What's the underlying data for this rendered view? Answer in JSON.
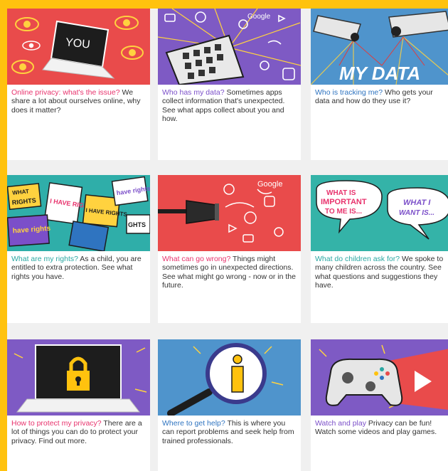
{
  "colors": {
    "frame": "#ffc20e",
    "pink": "#e8336d",
    "purple": "#7b4fc9",
    "teal": "#2aa7a2",
    "blue": "#2f74c0"
  },
  "cards": [
    {
      "name": "online-privacy",
      "title": "Online privacy: what's the issue?",
      "title_color": "#e8336d",
      "body": "We share a lot about ourselves online, why does it matter?",
      "image": {
        "icon": "laptop-eyes-icon",
        "label": "YOU"
      }
    },
    {
      "name": "who-has-my-data",
      "title": "Who has my data?",
      "title_color": "#7b4fc9",
      "body": "Sometimes apps collect information that's unexpected. See what apps collect about you and how.",
      "image": {
        "icon": "phone-apps-icon",
        "label": "Google"
      }
    },
    {
      "name": "who-is-tracking-me",
      "title": "Who is tracking me?",
      "title_color": "#2f74c0",
      "body": "Who gets your data and how do they use it?",
      "image": {
        "icon": "cctv-camera-icon",
        "label": "MY DATA"
      }
    },
    {
      "name": "what-are-my-rights",
      "title": "What are my rights?",
      "title_color": "#2aa7a2",
      "body": "As a child, you are entitled to extra protection. See what rights you have.",
      "image": {
        "icon": "protest-signs-icon",
        "signs": [
          "WHAT",
          "RIGHTS",
          "I HAVE RIGHTS",
          "have rights",
          "I HAVE RIGHTS",
          "have rights",
          "GHTS"
        ]
      }
    },
    {
      "name": "what-can-go-wrong",
      "title": "What can go wrong?",
      "title_color": "#e8336d",
      "body": "Things might sometimes go in unexpected directions. See what might go wrong - now or in the future.",
      "image": {
        "icon": "vacuum-cleaner-icon",
        "label": "Google"
      }
    },
    {
      "name": "what-do-children-ask-for",
      "title": "What do children ask for?",
      "title_color": "#2aa7a2",
      "body": "We spoke to many children across the country. See what questions and suggestions they have.",
      "image": {
        "icon": "speech-bubbles-icon",
        "bubble_left": [
          "WHAT IS",
          "IMPORTANT",
          "TO ME IS..."
        ],
        "bubble_right": [
          "WHAT I",
          "WANT IS..."
        ]
      }
    },
    {
      "name": "how-to-protect-my-privacy",
      "title": "How to protect my privacy?",
      "title_color": "#e8336d",
      "body": "There are a lot of things you can do to protect your privacy. Find out more.",
      "image": {
        "icon": "laptop-padlock-icon"
      }
    },
    {
      "name": "where-to-get-help",
      "title": "Where to get help?",
      "title_color": "#2f74c0",
      "body": "This is where you can report problems and seek help from trained professionals.",
      "image": {
        "icon": "magnifier-info-icon"
      }
    },
    {
      "name": "watch-and-play",
      "title": "Watch and play",
      "title_color": "#7b4fc9",
      "body": "Privacy can be fun! Watch some videos and play games.",
      "image": {
        "icon": "game-controller-icon"
      }
    }
  ]
}
